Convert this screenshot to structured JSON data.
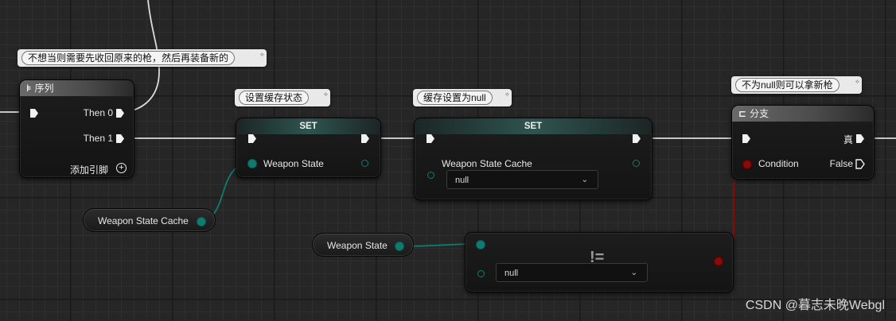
{
  "comments": {
    "sequence": "不想当则需要先收回原来的枪，然后再装备新的",
    "set_cache": "设置缓存状态",
    "set_null": "缓存设置为null",
    "branch": "不为null则可以拿新枪"
  },
  "sequence_node": {
    "icon": "sequence-icon",
    "title": "序列",
    "then0": "Then 0",
    "then1": "Then 1",
    "add_pin": "添加引脚"
  },
  "set_node_1": {
    "title": "SET",
    "input": "Weapon State"
  },
  "set_node_2": {
    "title": "SET",
    "input": "Weapon State Cache",
    "value": "null"
  },
  "get_cache": {
    "label": "Weapon State Cache"
  },
  "get_state": {
    "label": "Weapon State"
  },
  "compare_node": {
    "operator": "!=",
    "value": "null"
  },
  "branch_node": {
    "icon": "branch-icon",
    "title": "分支",
    "condition": "Condition",
    "true_label": "真",
    "false_label": "False"
  },
  "colors": {
    "exec_wire": "#e8e8e8",
    "object_wire": "#0e7c70",
    "bool_wire": "#8a0a0a"
  },
  "watermark": "CSDN @暮志未晚Webgl"
}
